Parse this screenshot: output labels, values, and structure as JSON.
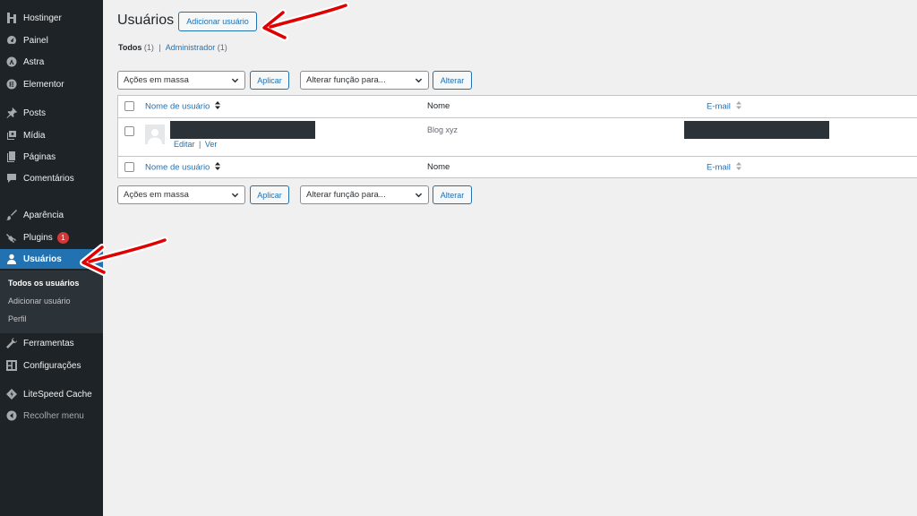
{
  "sidebar": {
    "items": [
      {
        "label": "Hostinger",
        "icon": "hostinger-icon"
      },
      {
        "label": "Painel",
        "icon": "dashboard-icon"
      },
      {
        "label": "Astra",
        "icon": "astra-icon"
      },
      {
        "label": "Elementor",
        "icon": "elementor-icon"
      },
      {
        "label": "Posts",
        "icon": "pin-icon"
      },
      {
        "label": "Mídia",
        "icon": "media-icon"
      },
      {
        "label": "Páginas",
        "icon": "page-icon"
      },
      {
        "label": "Comentários",
        "icon": "comment-icon"
      },
      {
        "label": "Aparência",
        "icon": "brush-icon"
      },
      {
        "label": "Plugins",
        "icon": "plugin-icon",
        "badge": "1"
      },
      {
        "label": "Usuários",
        "icon": "user-icon",
        "active": true
      },
      {
        "label": "Ferramentas",
        "icon": "wrench-icon"
      },
      {
        "label": "Configurações",
        "icon": "settings-icon"
      },
      {
        "label": "LiteSpeed Cache",
        "icon": "litespeed-icon"
      },
      {
        "label": "Recolher menu",
        "icon": "collapse-icon"
      }
    ],
    "submenu": [
      {
        "label": "Todos os usuários",
        "current": true
      },
      {
        "label": "Adicionar usuário"
      },
      {
        "label": "Perfil"
      }
    ]
  },
  "page": {
    "title": "Usuários",
    "add_button": "Adicionar usuário",
    "filters": {
      "all_label": "Todos",
      "all_count": "(1)",
      "separator": "|",
      "admin_label": "Administrador",
      "admin_count": "(1)"
    }
  },
  "toolbar": {
    "bulk_actions": "Ações em massa",
    "apply": "Aplicar",
    "change_role": "Alterar função para...",
    "change": "Alterar"
  },
  "table": {
    "columns": {
      "username": "Nome de usuário",
      "name": "Nome",
      "email": "E-mail"
    },
    "rows": [
      {
        "name": "Blog xyz",
        "actions": [
          "Editar",
          "Ver"
        ],
        "action_separator": "|"
      }
    ]
  },
  "colors": {
    "sidebar_bg": "#1d2327",
    "active_bg": "#2271b1",
    "accent": "#2271b1",
    "badge": "#d63638",
    "annotation": "#e00000"
  }
}
